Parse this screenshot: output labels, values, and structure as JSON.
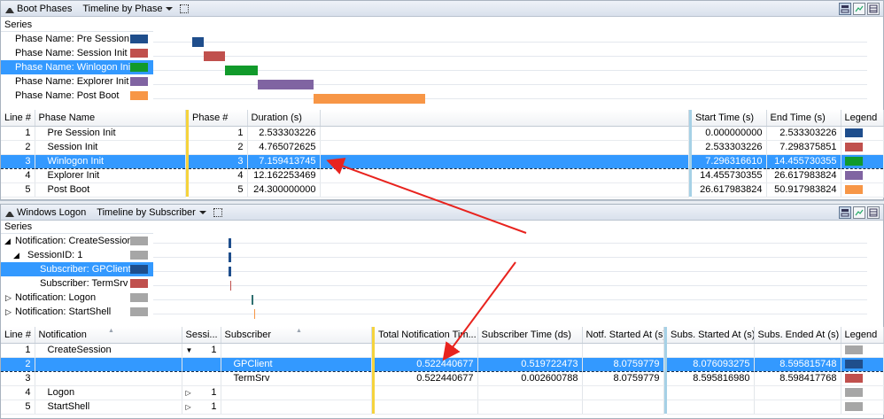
{
  "top": {
    "title": "Boot Phases",
    "view": "Timeline by Phase",
    "series_header": "Series",
    "series": [
      {
        "label": "Phase Name: Pre Session I...",
        "color": "#1f4e8c"
      },
      {
        "label": "Phase Name: Session Init",
        "color": "#c0504d"
      },
      {
        "label": "Phase Name: Winlogon Init",
        "color": "#119a2b"
      },
      {
        "label": "Phase Name: Explorer Init",
        "color": "#8064a2"
      },
      {
        "label": "Phase Name: Post Boot",
        "color": "#f79646"
      }
    ],
    "columns": [
      "Line #",
      "Phase Name",
      "",
      "Phase #",
      "Duration (s)",
      "",
      "",
      "Start Time (s)",
      "End Time (s)",
      "Legend"
    ],
    "rows": [
      {
        "line": "1",
        "name": "Pre Session Init",
        "phase": "1",
        "duration": "2.533303226",
        "start": "0.000000000",
        "end": "2.533303226",
        "color": "#1f4e8c"
      },
      {
        "line": "2",
        "name": "Session Init",
        "phase": "2",
        "duration": "4.765072625",
        "start": "2.533303226",
        "end": "7.298375851",
        "color": "#c0504d"
      },
      {
        "line": "3",
        "name": "Winlogon Init",
        "phase": "3",
        "duration": "7.159413745",
        "start": "7.296316610",
        "end": "14.455730355",
        "color": "#119a2b"
      },
      {
        "line": "4",
        "name": "Explorer Init",
        "phase": "4",
        "duration": "12.162253469",
        "start": "14.455730355",
        "end": "26.617983824",
        "color": "#8064a2"
      },
      {
        "line": "5",
        "name": "Post Boot",
        "phase": "5",
        "duration": "24.300000000",
        "start": "26.617983824",
        "end": "50.917983824",
        "color": "#f79646"
      }
    ]
  },
  "bottom": {
    "title": "Windows Logon",
    "view": "Timeline by Subscriber",
    "series_header": "Series",
    "series": [
      {
        "label": "Notification: CreateSession",
        "color": "#a6a6a6"
      },
      {
        "label": "SessionID: 1",
        "color": "#a6a6a6"
      },
      {
        "label": "Subscriber: GPClient",
        "color": "#1f4e8c"
      },
      {
        "label": "Subscriber: TermSrv",
        "color": "#c0504d"
      },
      {
        "label": "Notification: Logon",
        "color": "#a6a6a6"
      },
      {
        "label": "Notification: StartShell",
        "color": "#a6a6a6"
      }
    ],
    "columns": [
      "Line #",
      "Notification",
      "Sessi...",
      "Subscriber",
      "Total Notification Tim...",
      "Subscriber Time (ds)",
      "Notf. Started At (s)",
      "Subs. Started At (s)",
      "Subs. Ended At (s)",
      "Legend"
    ],
    "rows": [
      {
        "line": "1",
        "notification": "CreateSession",
        "session": "1",
        "subscriber": "",
        "total": "",
        "subtime": "",
        "notf_start": "",
        "subs_start": "",
        "subs_end": "",
        "color": "#a6a6a6"
      },
      {
        "line": "2",
        "notification": "",
        "session": "",
        "subscriber": "GPClient",
        "total": "0.522440677",
        "subtime": "0.519722473",
        "notf_start": "8.0759779",
        "subs_start": "8.076093275",
        "subs_end": "8.595815748",
        "color": "#1f4e8c"
      },
      {
        "line": "3",
        "notification": "",
        "session": "",
        "subscriber": "TermSrv",
        "total": "0.522440677",
        "subtime": "0.002600788",
        "notf_start": "8.0759779",
        "subs_start": "8.595816980",
        "subs_end": "8.598417768",
        "color": "#c0504d"
      },
      {
        "line": "4",
        "notification": "Logon",
        "session": "1",
        "subscriber": "",
        "total": "",
        "subtime": "",
        "notf_start": "",
        "subs_start": "",
        "subs_end": "",
        "color": "#a6a6a6"
      },
      {
        "line": "5",
        "notification": "StartShell",
        "session": "1",
        "subscriber": "",
        "total": "",
        "subtime": "",
        "notf_start": "",
        "subs_start": "",
        "subs_end": "",
        "color": "#a6a6a6"
      }
    ]
  }
}
